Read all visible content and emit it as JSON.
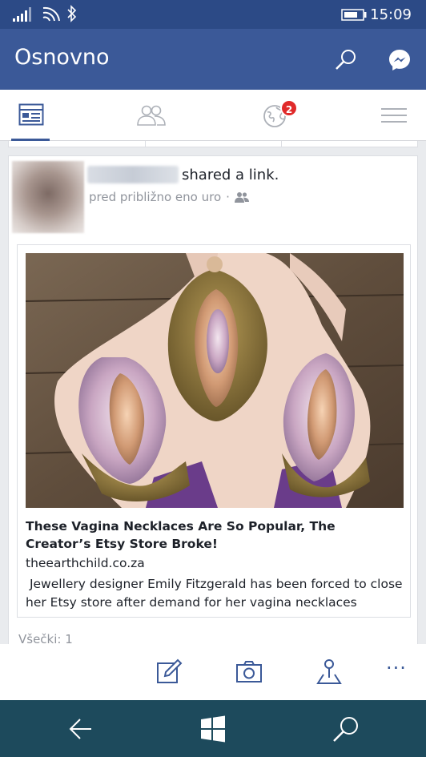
{
  "status_bar": {
    "time": "15:09",
    "icons": [
      "signal-icon",
      "wifi-icon",
      "bluetooth-icon",
      "battery-icon"
    ]
  },
  "header": {
    "title": "Osnovno",
    "icons": [
      "search-icon",
      "messenger-icon"
    ]
  },
  "tabs": {
    "items": [
      "news-feed-icon",
      "friends-icon",
      "notifications-globe-icon",
      "menu-icon"
    ],
    "active": "news-feed-icon",
    "notification_count": "2"
  },
  "post": {
    "action": "shared a link.",
    "time": "pred približno eno uro",
    "separator": "·",
    "audience_icon": "friends-audience-icon",
    "link": {
      "title": "These Vagina Necklaces Are So Popular, The Creator’s Etsy Store Broke!",
      "domain": "theearthchild.co.za",
      "description": " Jewellery designer Emily Fitzgerald has been forced to close her Etsy store after demand for her vagina necklaces"
    },
    "footer_count": "Všečki: 1"
  },
  "app_bar": {
    "icons": [
      "post-icon",
      "camera-icon",
      "check-in-icon"
    ],
    "more": "···"
  },
  "system_nav": {
    "icons": [
      "back-icon",
      "windows-icon",
      "search-icon"
    ]
  },
  "colors": {
    "status_bar": "#2c4a86",
    "header": "#3b5998",
    "badge": "#e02a2a",
    "system_nav": "#1d4a5c",
    "accent": "#3b5998"
  }
}
